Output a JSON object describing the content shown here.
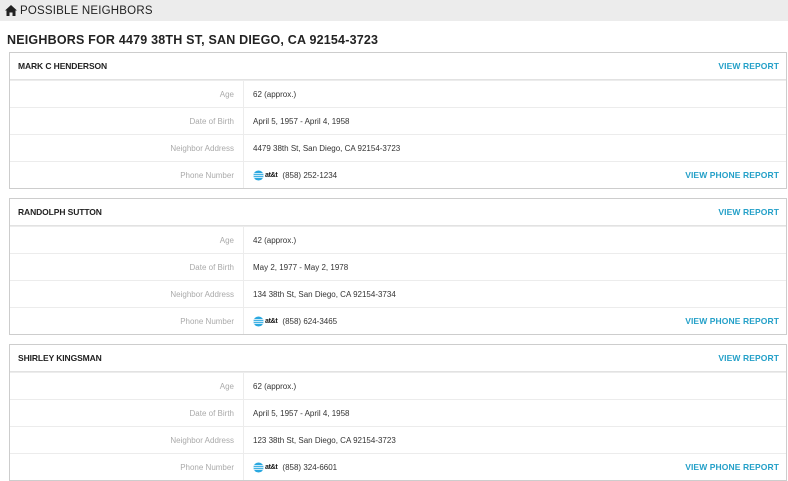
{
  "topbar": {
    "title": "POSSIBLE NEIGHBORS",
    "icon": "home-icon"
  },
  "heading": "NEIGHBORS FOR 4479 38TH ST, SAN DIEGO, CA 92154-3723",
  "labels": {
    "age": "Age",
    "dob": "Date of Birth",
    "address": "Neighbor Address",
    "phone": "Phone Number",
    "view_report": "VIEW REPORT",
    "view_phone_report": "VIEW PHONE REPORT",
    "carrier": "at&t"
  },
  "neighbors": [
    {
      "name": "MARK C HENDERSON",
      "age": "62 (approx.)",
      "dob": "April 5, 1957 - April 4, 1958",
      "address": "4479 38th St, San Diego, CA 92154-3723",
      "phone": "(858) 252-1234"
    },
    {
      "name": "RANDOLPH SUTTON",
      "age": "42 (approx.)",
      "dob": "May 2, 1977 - May 2, 1978",
      "address": "134 38th St, San Diego, CA 92154-3734",
      "phone": "(858) 624-3465"
    },
    {
      "name": "SHIRLEY KINGSMAN",
      "age": "62 (approx.)",
      "dob": "April 5, 1957 - April 4, 1958",
      "address": "123 38th St, San Diego, CA 92154-3723",
      "phone": "(858) 324-6601"
    }
  ],
  "colors": {
    "link": "#24a0c8",
    "topbar_bg": "#ececec",
    "border": "#cdcdcd"
  }
}
